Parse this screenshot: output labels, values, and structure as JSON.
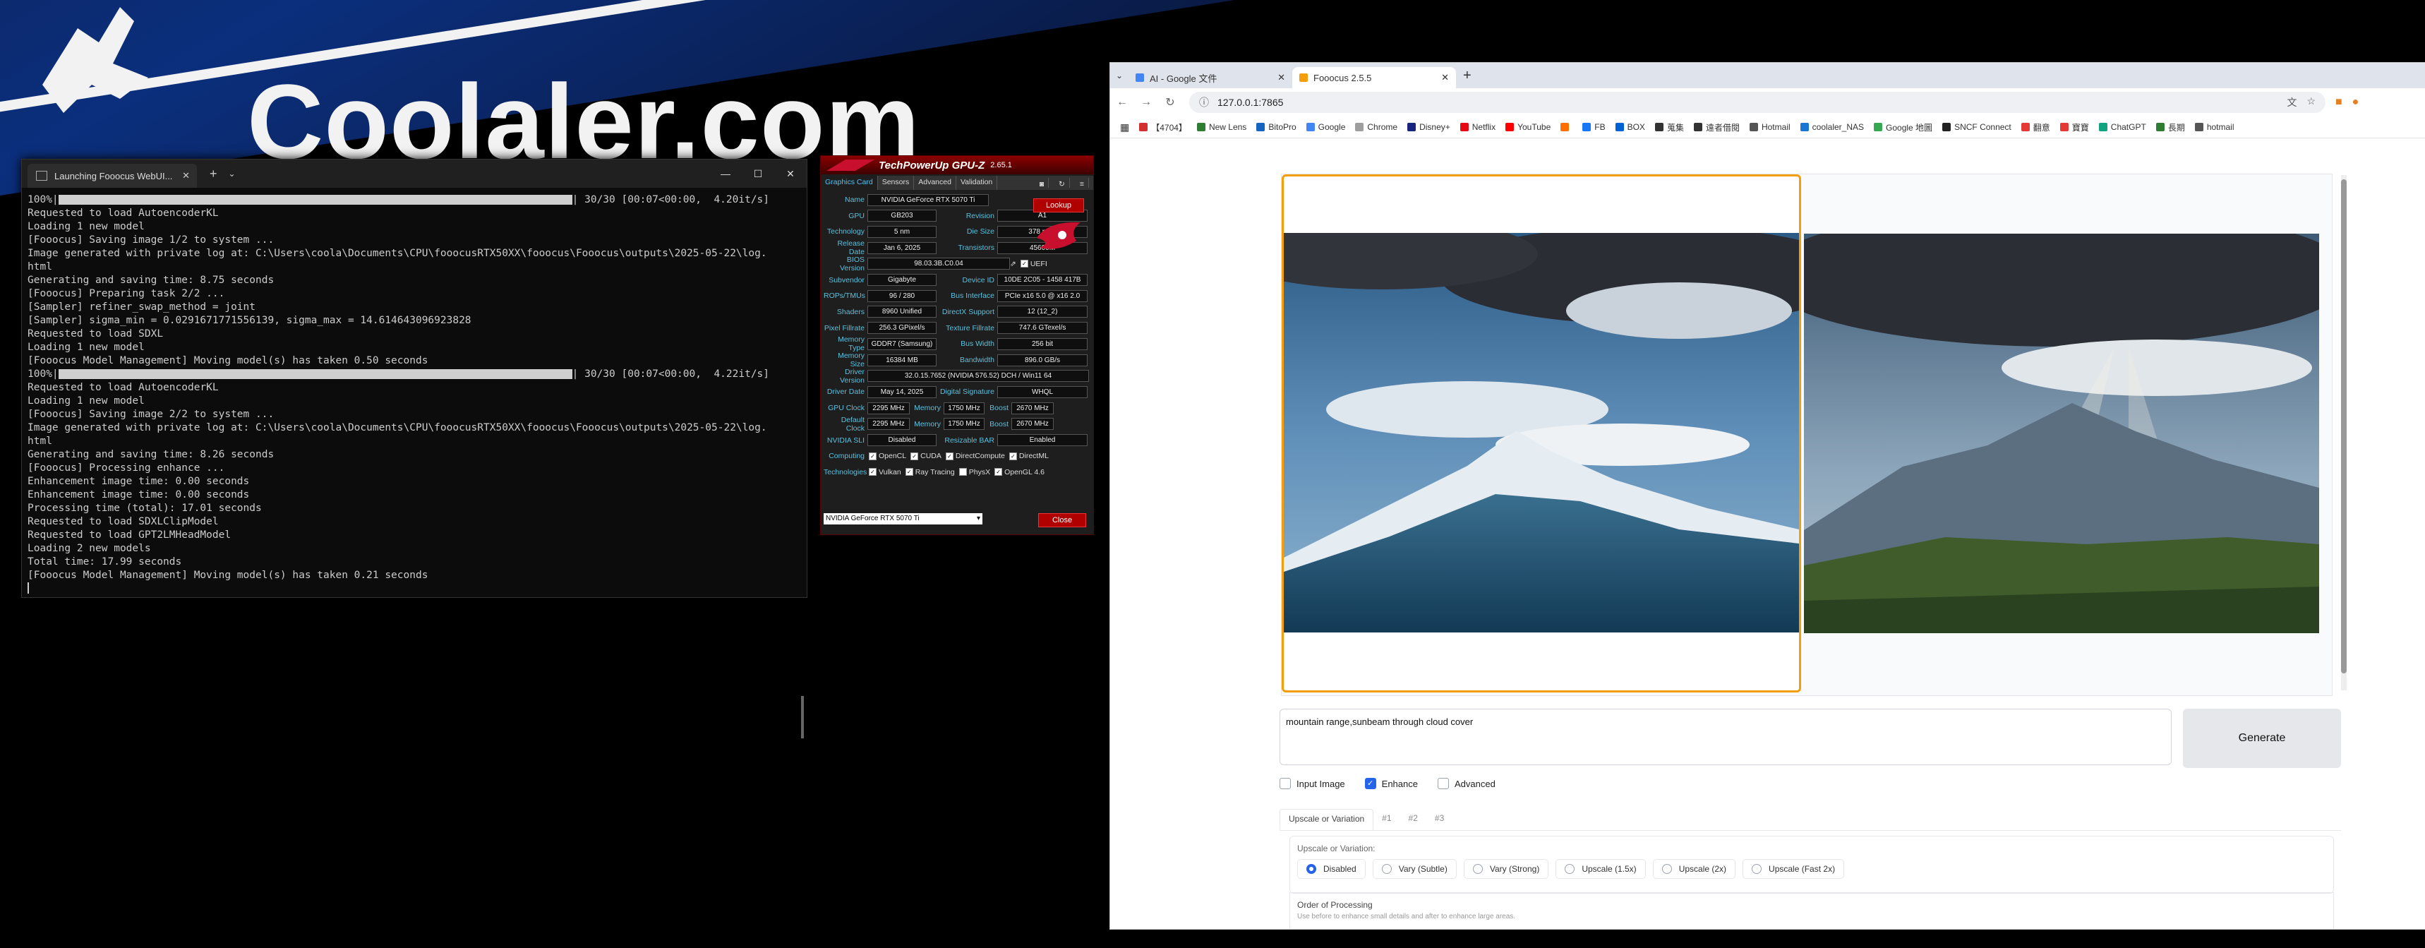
{
  "wallpaper": {
    "brand": "Coolaler.com"
  },
  "terminal": {
    "tab_title": "Launching Fooocus WebUI...",
    "lines": [
      {
        "pre": "100%|",
        "bar": true,
        "post": "| 30/30 [00:07<00:00,  4.20it/s]"
      },
      {
        "text": "Requested to load AutoencoderKL"
      },
      {
        "text": "Loading 1 new model"
      },
      {
        "text": "[Fooocus] Saving image 1/2 to system ..."
      },
      {
        "text": "Image generated with private log at: C:\\Users\\coola\\Documents\\CPU\\fooocusRTX50XX\\fooocus\\Fooocus\\outputs\\2025-05-22\\log."
      },
      {
        "text": "html"
      },
      {
        "text": "Generating and saving time: 8.75 seconds"
      },
      {
        "text": "[Fooocus] Preparing task 2/2 ..."
      },
      {
        "text": "[Sampler] refiner_swap_method = joint"
      },
      {
        "text": "[Sampler] sigma_min = 0.0291671771556139, sigma_max = 14.614643096923828"
      },
      {
        "text": "Requested to load SDXL"
      },
      {
        "text": "Loading 1 new model"
      },
      {
        "text": "[Fooocus Model Management] Moving model(s) has taken 0.50 seconds"
      },
      {
        "pre": "100%|",
        "bar": true,
        "post": "| 30/30 [00:07<00:00,  4.22it/s]"
      },
      {
        "text": "Requested to load AutoencoderKL"
      },
      {
        "text": "Loading 1 new model"
      },
      {
        "text": "[Fooocus] Saving image 2/2 to system ..."
      },
      {
        "text": "Image generated with private log at: C:\\Users\\coola\\Documents\\CPU\\fooocusRTX50XX\\fooocus\\Fooocus\\outputs\\2025-05-22\\log."
      },
      {
        "text": "html"
      },
      {
        "text": "Generating and saving time: 8.26 seconds"
      },
      {
        "text": "[Fooocus] Processing enhance ..."
      },
      {
        "text": "Enhancement image time: 0.00 seconds"
      },
      {
        "text": "Enhancement image time: 0.00 seconds"
      },
      {
        "text": "Processing time (total): 17.01 seconds"
      },
      {
        "text": "Requested to load SDXLClipModel"
      },
      {
        "text": "Requested to load GPT2LMHeadModel"
      },
      {
        "text": "Loading 2 new models"
      },
      {
        "text": "Total time: 17.99 seconds"
      },
      {
        "text": "[Fooocus Model Management] Moving model(s) has taken 0.21 seconds"
      }
    ]
  },
  "gpuz": {
    "title": "TechPowerUp GPU-Z",
    "version": "2.65.1",
    "tabs": [
      "Graphics Card",
      "Sensors",
      "Advanced",
      "Validation"
    ],
    "lookup": "Lookup",
    "close": "Close",
    "uefi": "UEFI",
    "selected_gpu": "NVIDIA GeForce RTX 5070 Ti",
    "rows": [
      {
        "l1": "Name",
        "v1": "NVIDIA GeForce RTX 5070 Ti"
      },
      {
        "l1": "GPU",
        "v1": "GB203",
        "l2": "Revision",
        "v2": "A1"
      },
      {
        "l1": "Technology",
        "v1": "5 nm",
        "l2": "Die Size",
        "v2": "378 mm²"
      },
      {
        "l1": "Release Date",
        "v1": "Jan 6, 2025",
        "l2": "Transistors",
        "v2": "45600M"
      },
      {
        "l1": "BIOS Version",
        "v1": "98.03.3B.C0.04"
      },
      {
        "l1": "Subvendor",
        "v1": "Gigabyte",
        "l2": "Device ID",
        "v2": "10DE 2C05 - 1458 417B"
      },
      {
        "l1": "ROPs/TMUs",
        "v1": "96 / 280",
        "l2": "Bus Interface",
        "v2": "PCIe x16 5.0 @ x16 2.0"
      },
      {
        "l1": "Shaders",
        "v1": "8960 Unified",
        "l2": "DirectX Support",
        "v2": "12 (12_2)"
      },
      {
        "l1": "Pixel Fillrate",
        "v1": "256.3 GPixel/s",
        "l2": "Texture Fillrate",
        "v2": "747.6 GTexel/s"
      },
      {
        "l1": "Memory Type",
        "v1": "GDDR7 (Samsung)",
        "l2": "Bus Width",
        "v2": "256 bit"
      },
      {
        "l1": "Memory Size",
        "v1": "16384 MB",
        "l2": "Bandwidth",
        "v2": "896.0 GB/s"
      },
      {
        "l1": "Driver Version",
        "v1": "32.0.15.7652 (NVIDIA 576.52) DCH / Win11 64"
      },
      {
        "l1": "Driver Date",
        "v1": "May 14, 2025",
        "l2": "Digital Signature",
        "v2": "WHQL"
      },
      {
        "l1": "GPU Clock",
        "v1": "2295 MHz",
        "l2": "Memory",
        "v2": "1750 MHz",
        "l3": "Boost",
        "v3": "2670 MHz"
      },
      {
        "l1": "Default Clock",
        "v1": "2295 MHz",
        "l2": "Memory",
        "v2": "1750 MHz",
        "l3": "Boost",
        "v3": "2670 MHz"
      },
      {
        "l1": "NVIDIA SLI",
        "v1": "Disabled",
        "l2": "Resizable BAR",
        "v2": "Enabled"
      }
    ],
    "computing_label": "Computing",
    "computing": [
      "OpenCL",
      "CUDA",
      "DirectCompute",
      "DirectML"
    ],
    "technologies_label": "Technologies",
    "technologies": [
      {
        "name": "Vulkan",
        "on": true
      },
      {
        "name": "Ray Tracing",
        "on": true
      },
      {
        "name": "PhysX",
        "on": false
      },
      {
        "name": "OpenGL 4.6",
        "on": true
      }
    ]
  },
  "browser": {
    "tabs": [
      {
        "title": "AI - Google 文件",
        "active": false
      },
      {
        "title": "Fooocus 2.5.5",
        "active": true
      }
    ],
    "url": "127.0.0.1:7865",
    "bookmarks": [
      {
        "label": "【4704】",
        "color": "#d32f2f"
      },
      {
        "label": "New Lens",
        "color": "#2e7d32"
      },
      {
        "label": "BitoPro",
        "color": "#1565c0"
      },
      {
        "label": "Google",
        "color": "#4285f4"
      },
      {
        "label": "Chrome",
        "color": "#9e9e9e"
      },
      {
        "label": "Disney+",
        "color": "#1a237e"
      },
      {
        "label": "Netflix",
        "color": "#e50914"
      },
      {
        "label": "YouTube",
        "color": "#ff0000"
      },
      {
        "label": "",
        "color": "#ff6f00"
      },
      {
        "label": "FB",
        "color": "#1877f2"
      },
      {
        "label": "BOX",
        "color": "#0061d5"
      },
      {
        "label": "蒐集",
        "color": "#333333"
      },
      {
        "label": "遠者借閱",
        "color": "#333333"
      },
      {
        "label": "Hotmail",
        "color": "#555555"
      },
      {
        "label": "coolaler_NAS",
        "color": "#1976d2"
      },
      {
        "label": "Google 地圖",
        "color": "#34a853"
      },
      {
        "label": "SNCF Connect",
        "color": "#222222"
      },
      {
        "label": "翻意",
        "color": "#e53935"
      },
      {
        "label": "寶寶",
        "color": "#e53935"
      },
      {
        "label": "ChatGPT",
        "color": "#10a37f"
      },
      {
        "label": "長期",
        "color": "#2e7d32"
      },
      {
        "label": "hotmail",
        "color": "#555555"
      }
    ]
  },
  "fooocus": {
    "prompt": "mountain range,sunbeam through cloud cover",
    "generate": "Generate",
    "checks": [
      {
        "label": "Input Image",
        "on": false
      },
      {
        "label": "Enhance",
        "on": true
      },
      {
        "label": "Advanced",
        "on": false
      }
    ],
    "tabs": [
      "Upscale or Variation",
      "#1",
      "#2",
      "#3"
    ],
    "upscale_label": "Upscale or Variation:",
    "options": [
      {
        "label": "Disabled",
        "on": true
      },
      {
        "label": "Vary (Subtle)",
        "on": false
      },
      {
        "label": "Vary (Strong)",
        "on": false
      },
      {
        "label": "Upscale (1.5x)",
        "on": false
      },
      {
        "label": "Upscale (2x)",
        "on": false
      },
      {
        "label": "Upscale (Fast 2x)",
        "on": false
      }
    ],
    "order_title": "Order of Processing",
    "order_desc": "Use before to enhance small details and after to enhance large areas."
  }
}
